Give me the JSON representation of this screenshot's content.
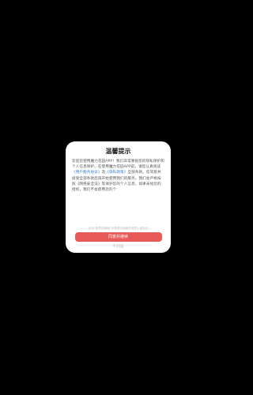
{
  "dialog": {
    "title": "温馨提示",
    "body": {
      "part1": "欢迎您使用魔力花园APP！我们非常重视您的隐私保护和个人信息保护。在使用魔力花园APP前，请您认真阅读",
      "link1": "《用户服务协议》",
      "part2": "及",
      "link2": "《隐私政策》",
      "part3": "全部条款。您同意并接受全部条款后再开始使用我们的服务。我们会严格按照《网络安全法》等保护您的个人信息，如果未经您的授权，我们不会使用您的个"
    },
    "hint": "点击“同意并继续”代表您已阅读并同意上述协议",
    "agree_label": "同意并继续",
    "disagree_label": "不同意"
  }
}
